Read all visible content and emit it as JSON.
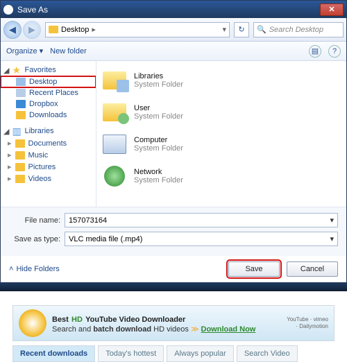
{
  "title": "Save As",
  "breadcrumb": "Desktop",
  "search_placeholder": "Search Desktop",
  "toolbar": {
    "organize": "Organize",
    "newfolder": "New folder"
  },
  "sidebar": {
    "favorites": "Favorites",
    "items_fav": [
      "Desktop",
      "Recent Places",
      "Dropbox",
      "Downloads"
    ],
    "libraries": "Libraries",
    "items_lib": [
      "Documents",
      "Music",
      "Pictures",
      "Videos"
    ]
  },
  "content": [
    {
      "name": "Libraries",
      "sub": "System Folder"
    },
    {
      "name": "User",
      "sub": "System Folder"
    },
    {
      "name": "Computer",
      "sub": "System Folder"
    },
    {
      "name": "Network",
      "sub": "System Folder"
    }
  ],
  "filename_label": "File name:",
  "filename_value": "157073164",
  "filetype_label": "Save as type:",
  "filetype_value": "VLC media file (.mp4)",
  "hide_folders": "Hide Folders",
  "save_btn": "Save",
  "cancel_btn": "Cancel",
  "ad": {
    "line1_a": "Best",
    "line1_hd": "HD",
    "line1_b": "YouTube Video Downloader",
    "line2_a": "Search and",
    "line2_b": "batch download",
    "line2_c": "HD videos",
    "line2_dl": "Download Now",
    "brands": "YouTube · vimeo · Dailymotion"
  },
  "tabs": [
    "Recent downloads",
    "Today's hottest",
    "Always popular",
    "Search Video"
  ]
}
